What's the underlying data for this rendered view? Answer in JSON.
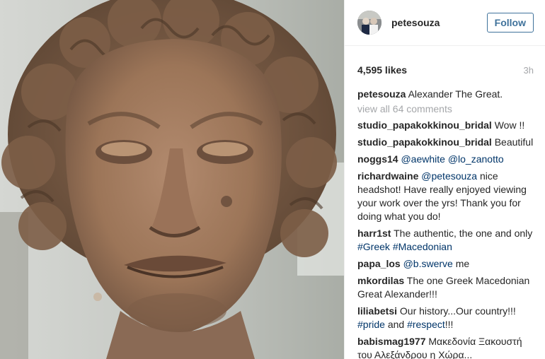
{
  "post": {
    "image_alt": "Marble head of Alexander the Great",
    "username": "petesouza",
    "follow_label": "Follow",
    "likes": "4,595 likes",
    "time": "3h",
    "caption_user": "petesouza",
    "caption_text": "Alexander The Great.",
    "view_all": "view all 64 comments"
  },
  "comments": [
    {
      "user": "studio_papakokkinou_bridal",
      "text": "Wow !!"
    },
    {
      "user": "studio_papakokkinou_bridal",
      "text": "Beautiful"
    },
    {
      "user": "noggs14",
      "mention1": "@aewhite",
      "mention2": "@lo_zanotto"
    },
    {
      "user": "richardwaine",
      "mention": "@petesouza",
      "text": "nice headshot! Have really enjoyed viewing your work over the yrs! Thank you for doing what you do!"
    },
    {
      "user": "harr1st",
      "text": "The authentic, the one and only",
      "tag1": "#Greek",
      "tag2": "#Macedonian"
    },
    {
      "user": "papa_los",
      "mention": "@b.swerve",
      "text": "me"
    },
    {
      "user": "mkordilas",
      "text": "The one Greek Macedonian Great Alexander!!!"
    },
    {
      "user": "liliabetsi",
      "text": "Our history...Our country!!!",
      "tag1": "#pride",
      "and": "and",
      "tag2": "#respect",
      "tail": "!!!"
    },
    {
      "user": "babismag1977",
      "text": "Μακεδονία Ξακουστή του Αλεξάνδρου η Χώρα..."
    }
  ],
  "colors": {
    "link": "#003569",
    "follow": "#3f729b",
    "muted": "#a5a7aa",
    "text": "#262626"
  }
}
